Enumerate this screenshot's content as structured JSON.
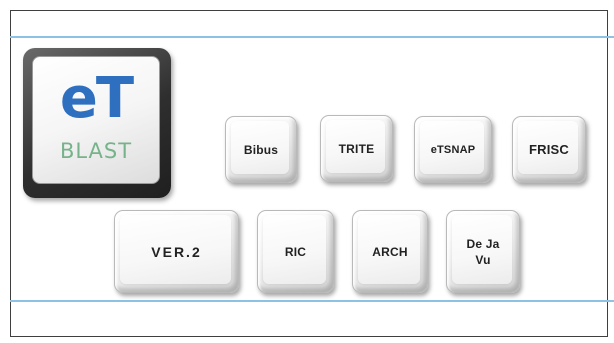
{
  "logo": {
    "mark": "eT",
    "word": "BLAST"
  },
  "keys": {
    "row1": [
      "Bibus",
      "TRITE",
      "eTSNAP",
      "FRISC"
    ],
    "row2": [
      "VER.2",
      "RIC",
      "ARCH",
      "De Ja Vu"
    ]
  },
  "colors": {
    "rule": "#8ec1e3",
    "logo_blue": "#2f6fc0",
    "logo_green": "#76b38a"
  }
}
